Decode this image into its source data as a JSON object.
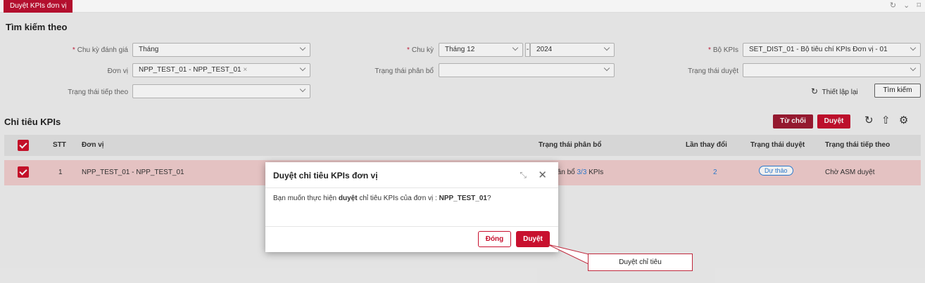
{
  "tab": {
    "label": "Duyệt KPIs đơn vị"
  },
  "search": {
    "title": "Tìm kiếm theo",
    "cycle_eval_label": "Chu kỳ đánh giá",
    "cycle_eval_value": "Tháng",
    "unit_label": "Đơn vị",
    "unit_value": "NPP_TEST_01 - NPP_TEST_01",
    "unit_clear": "×",
    "next_status_label": "Trạng thái tiếp theo",
    "cycle_label": "Chu kỳ",
    "cycle_month": "Tháng 12",
    "cycle_sep": "-",
    "cycle_year": "2024",
    "alloc_status_label": "Trạng thái phân bổ",
    "kpi_set_label": "Bộ KPIs",
    "kpi_set_value": "SET_DIST_01 - Bộ tiêu chí KPIs Đơn vị - 01",
    "approval_status_label": "Trạng thái duyệt",
    "reset_label": "Thiết lập lại",
    "search_button": "Tìm kiếm"
  },
  "kpi": {
    "title": "Chỉ tiêu KPIs",
    "reject_button": "Từ chối",
    "approve_button": "Duyệt",
    "columns": [
      "STT",
      "Đơn vị",
      "Trạng thái phân bổ",
      "Lần thay đổi",
      "Trạng thái duyệt",
      "Trạng thái tiếp theo"
    ],
    "row": {
      "stt": "1",
      "unit": "NPP_TEST_01 - NPP_TEST_01",
      "alloc_prefix": "Đã phân bổ",
      "alloc_count": "3/3",
      "alloc_suffix": "KPIs",
      "changes": "2",
      "approval": "Dự thảo",
      "next": "Chờ ASM duyệt"
    }
  },
  "modal": {
    "title": "Duyệt chỉ tiêu KPIs đơn vị",
    "body_pre": "Bạn muốn thực hiện ",
    "body_bold": "duyệt",
    "body_mid": " chỉ tiêu KPIs của đơn vị : ",
    "body_unit": "NPP_TEST_01",
    "body_end": "?",
    "close_button": "Đóng",
    "approve_button": "Duyệt"
  },
  "callout": {
    "text": "Duyệt chỉ tiêu"
  },
  "colors": {
    "brand_red": "#c8102e",
    "row_highlight": "#f3cfcf",
    "badge_blue": "#2f7fd6"
  }
}
